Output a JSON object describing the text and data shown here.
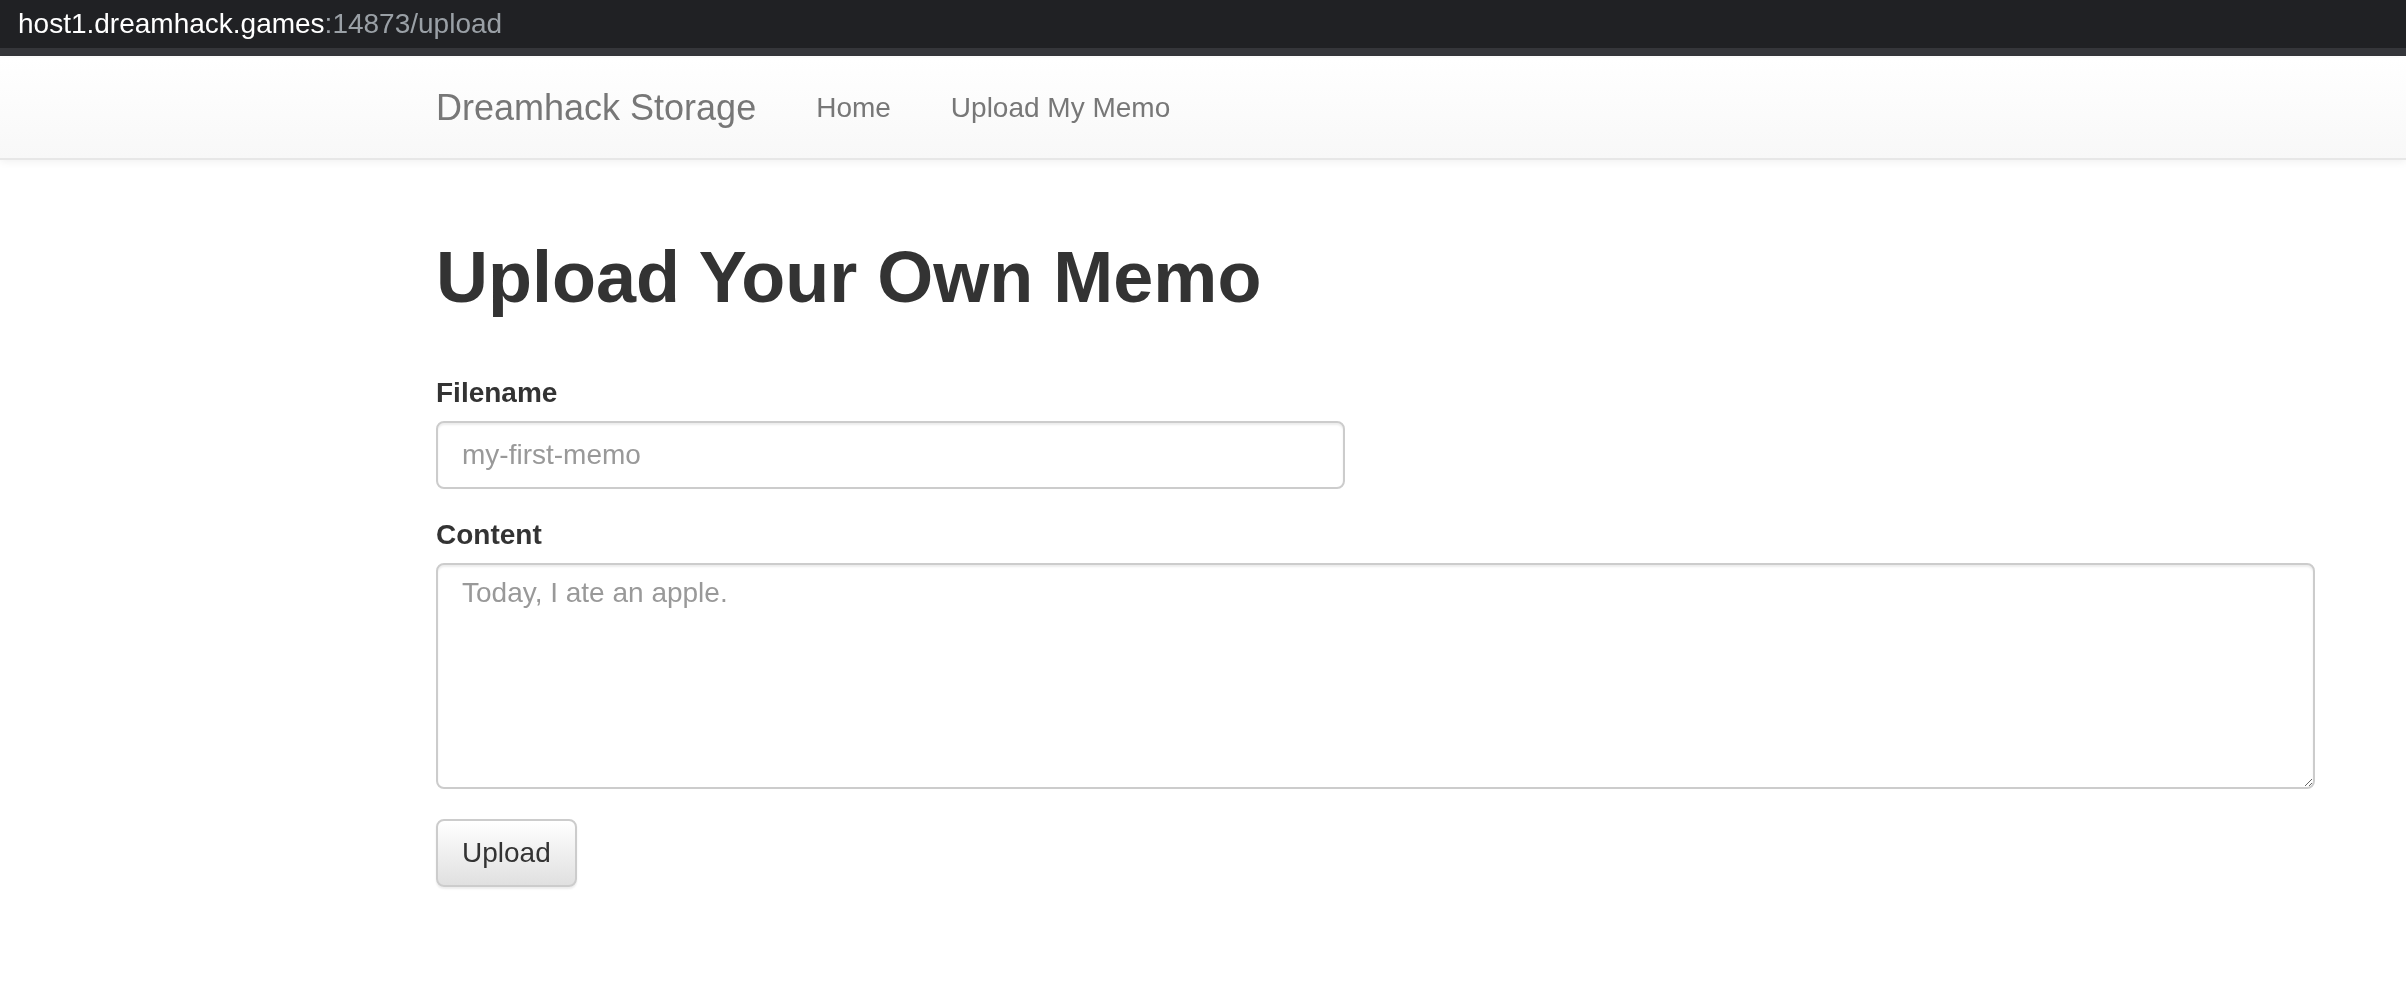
{
  "address_bar": {
    "host": "host1.dreamhack.games",
    "path": ":14873/upload"
  },
  "navbar": {
    "brand": "Dreamhack Storage",
    "links": [
      "Home",
      "Upload My Memo"
    ]
  },
  "heading": "Upload Your Own Memo",
  "form": {
    "filename": {
      "label": "Filename",
      "placeholder": "my-first-memo"
    },
    "content": {
      "label": "Content",
      "placeholder": "Today, I ate an apple."
    },
    "submit": "Upload"
  }
}
